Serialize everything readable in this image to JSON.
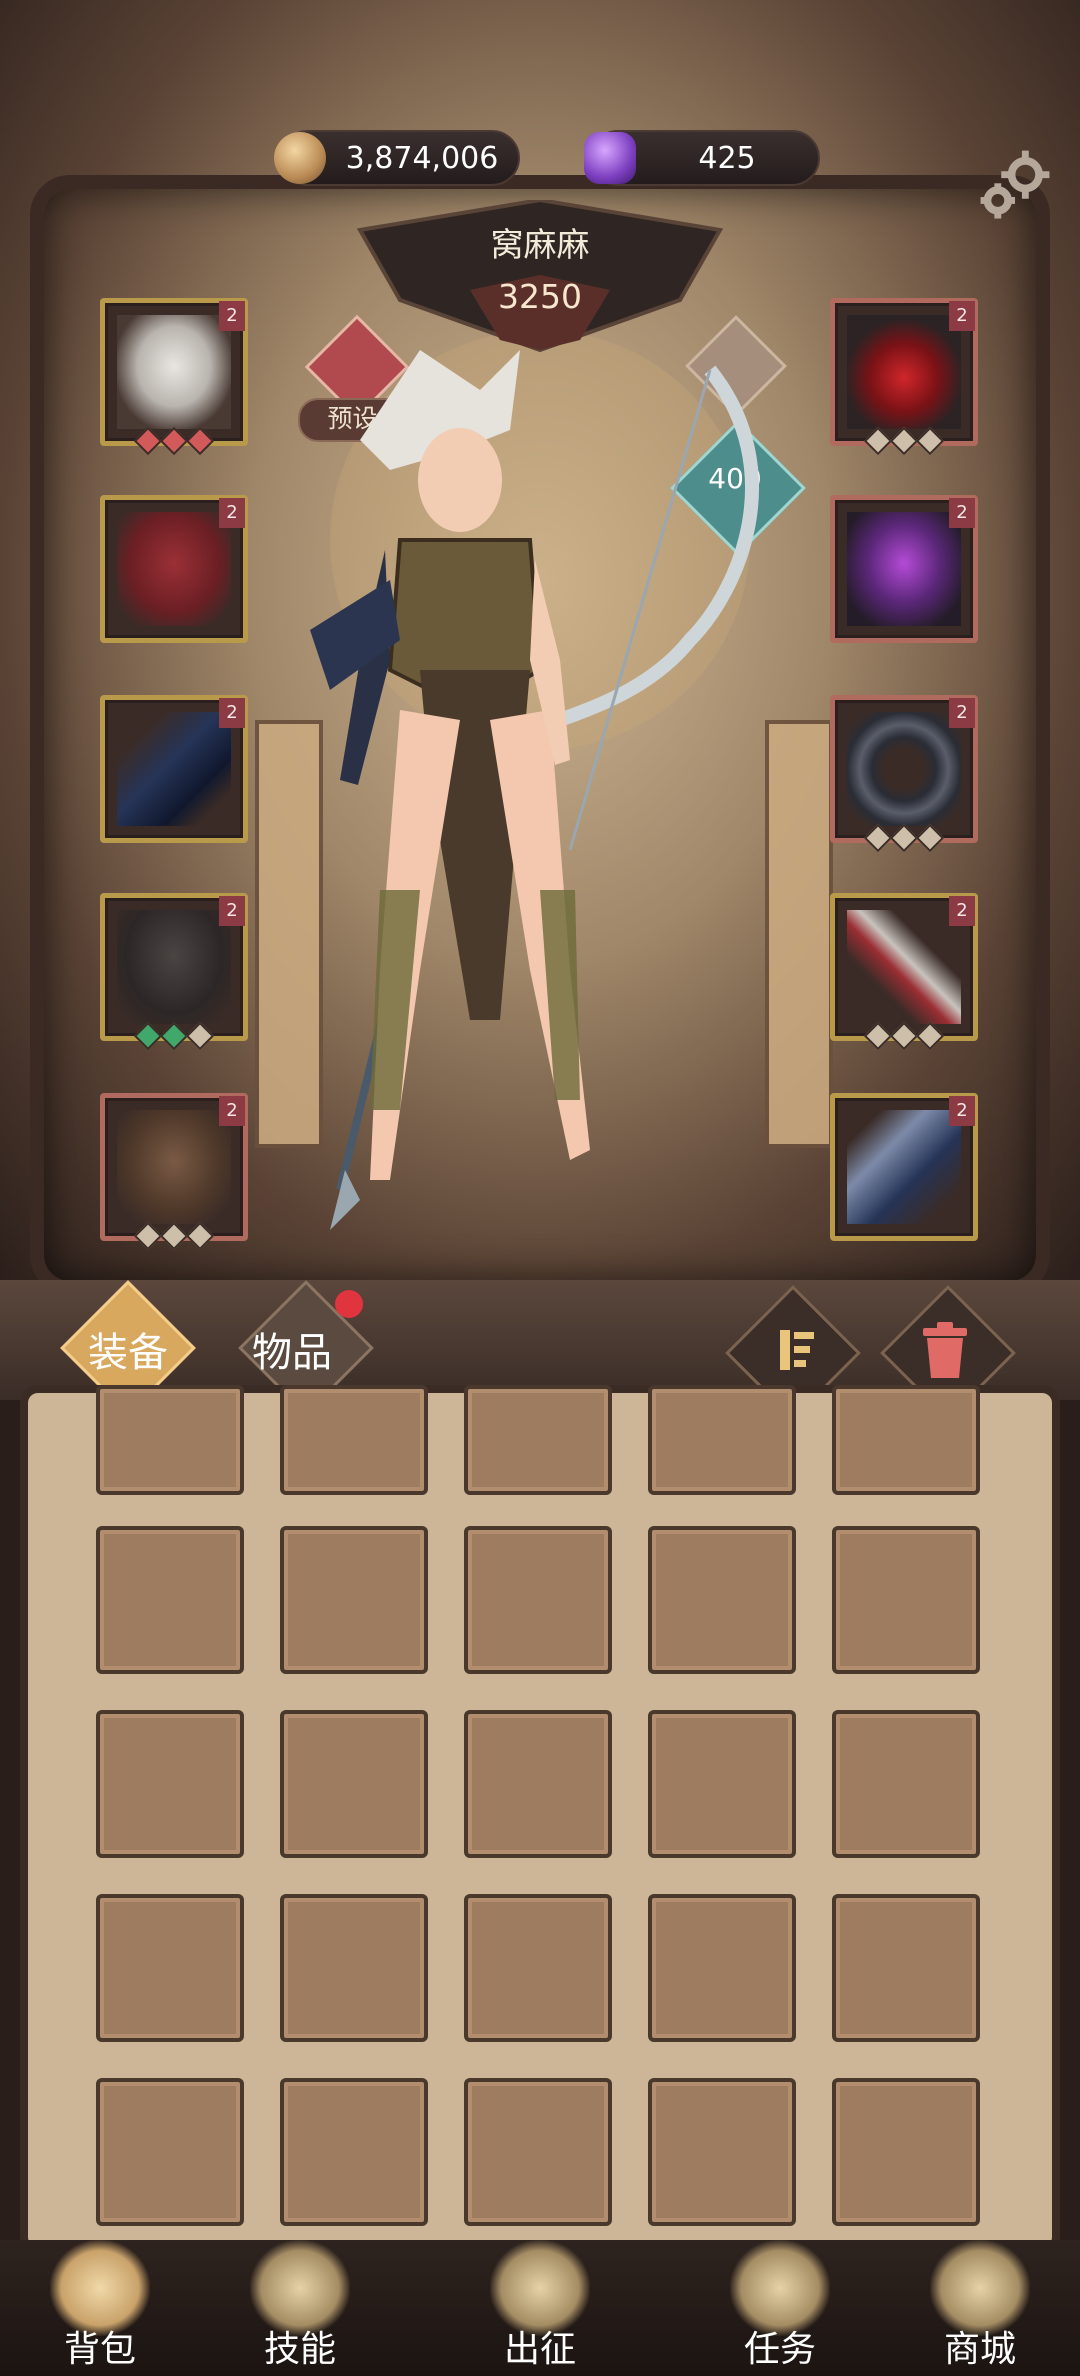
{
  "header": {
    "gold_amount": "3,874,006",
    "gem_amount": "425",
    "settings_icon": "gear-icon"
  },
  "character": {
    "name": "窝麻麻",
    "power": "3250",
    "preset_label": "预设二",
    "level_badge": "400"
  },
  "equipment": {
    "left": [
      {
        "name": "mask",
        "level": "2"
      },
      {
        "name": "chest-armor",
        "level": "2"
      },
      {
        "name": "cape",
        "level": "2"
      },
      {
        "name": "belt-shorts",
        "level": "2"
      },
      {
        "name": "boots",
        "level": "2"
      }
    ],
    "right": [
      {
        "name": "heart-amulet",
        "level": "2"
      },
      {
        "name": "purple-ring",
        "level": "2"
      },
      {
        "name": "dark-ring",
        "level": "2"
      },
      {
        "name": "crossbow",
        "level": "2"
      },
      {
        "name": "quiver",
        "level": "2"
      }
    ]
  },
  "tabs": {
    "equipment_label": "装备",
    "items_label": "物品"
  },
  "nav": {
    "bag": "背包",
    "skills": "技能",
    "battle": "出征",
    "quests": "任务",
    "shop": "商城"
  },
  "colors": {
    "gold_frame": "#b99a4a",
    "red_frame": "#b06a5e",
    "notification": "#e0343f"
  }
}
